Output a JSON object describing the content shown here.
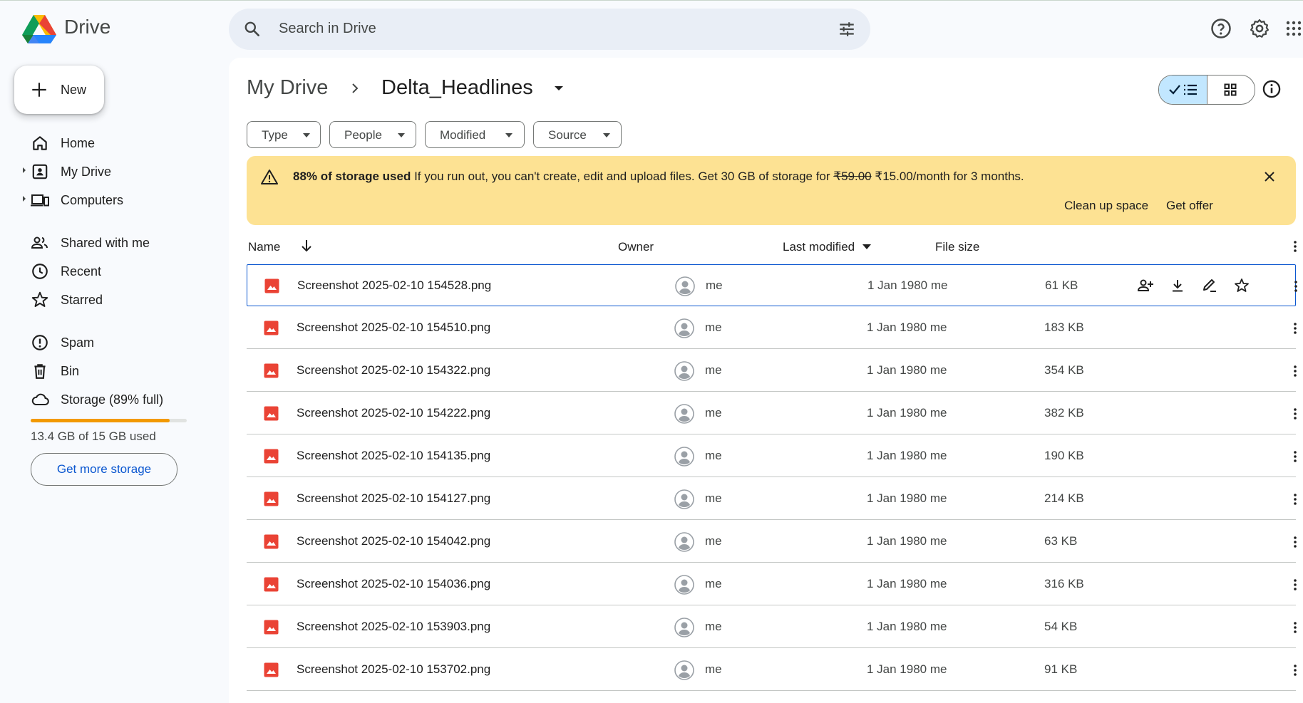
{
  "app": {
    "name": "Drive"
  },
  "search": {
    "placeholder": "Search in Drive"
  },
  "sidebar": {
    "new_label": "New",
    "items": [
      {
        "label": "Home",
        "icon": "home-icon"
      },
      {
        "label": "My Drive",
        "icon": "my-drive-icon"
      },
      {
        "label": "Computers",
        "icon": "computer-icon"
      },
      {
        "label": "Shared with me",
        "icon": "people-icon"
      },
      {
        "label": "Recent",
        "icon": "clock-icon"
      },
      {
        "label": "Starred",
        "icon": "star-icon"
      },
      {
        "label": "Spam",
        "icon": "spam-icon"
      },
      {
        "label": "Bin",
        "icon": "trash-icon"
      },
      {
        "label": "Storage (89% full)",
        "icon": "cloud-icon"
      }
    ],
    "storage_fraction": 0.89,
    "storage_text": "13.4 GB of 15 GB used",
    "get_storage_label": "Get more storage"
  },
  "breadcrumb": {
    "root": "My Drive",
    "current": "Delta_Headlines"
  },
  "filters": [
    "Type",
    "People",
    "Modified",
    "Source"
  ],
  "banner": {
    "bold": "88% of storage used",
    "text": "If you run out, you can't create, edit and upload files. Get 30 GB of storage for",
    "old_price": "₹59.00",
    "new_price": "₹15.00/month for 3 months.",
    "action1": "Clean up space",
    "action2": "Get offer"
  },
  "table": {
    "headers": {
      "name": "Name",
      "owner": "Owner",
      "modified": "Last modified",
      "size": "File size"
    },
    "rows": [
      {
        "name": "Screenshot 2025-02-10 154528.png",
        "owner": "me",
        "modified": "1 Jan 1980  me",
        "size": "61 KB"
      },
      {
        "name": "Screenshot 2025-02-10 154510.png",
        "owner": "me",
        "modified": "1 Jan 1980  me",
        "size": "183 KB"
      },
      {
        "name": "Screenshot 2025-02-10 154322.png",
        "owner": "me",
        "modified": "1 Jan 1980  me",
        "size": "354 KB"
      },
      {
        "name": "Screenshot 2025-02-10 154222.png",
        "owner": "me",
        "modified": "1 Jan 1980  me",
        "size": "382 KB"
      },
      {
        "name": "Screenshot 2025-02-10 154135.png",
        "owner": "me",
        "modified": "1 Jan 1980  me",
        "size": "190 KB"
      },
      {
        "name": "Screenshot 2025-02-10 154127.png",
        "owner": "me",
        "modified": "1 Jan 1980  me",
        "size": "214 KB"
      },
      {
        "name": "Screenshot 2025-02-10 154042.png",
        "owner": "me",
        "modified": "1 Jan 1980  me",
        "size": "63 KB"
      },
      {
        "name": "Screenshot 2025-02-10 154036.png",
        "owner": "me",
        "modified": "1 Jan 1980  me",
        "size": "316 KB"
      },
      {
        "name": "Screenshot 2025-02-10 153903.png",
        "owner": "me",
        "modified": "1 Jan 1980  me",
        "size": "54 KB"
      },
      {
        "name": "Screenshot 2025-02-10 153702.png",
        "owner": "me",
        "modified": "1 Jan 1980  me",
        "size": "91 KB"
      }
    ]
  },
  "colors": {
    "accent": "#0b57d0",
    "banner_bg": "#fde293",
    "storage_fill": "#f29900",
    "image_file_icon": "#ea4335"
  }
}
